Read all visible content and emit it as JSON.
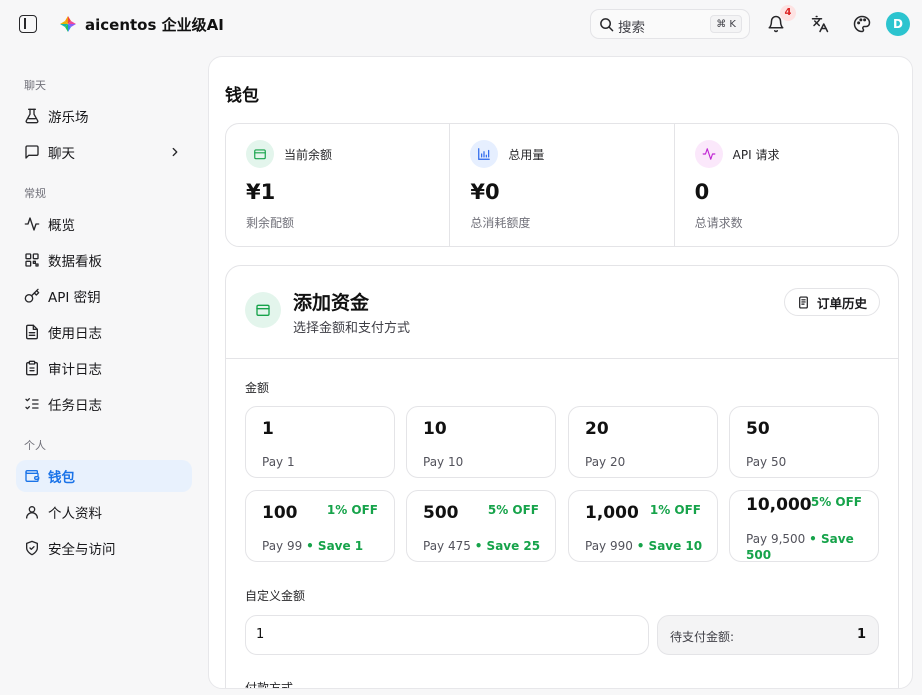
{
  "header": {
    "brand": "aicentos 企业级AI",
    "search_placeholder": "搜索",
    "search_shortcut": "⌘ K",
    "notification_count": "4",
    "avatar_initial": "D"
  },
  "sidebar": {
    "section_chat": "聊天",
    "section_general": "常规",
    "section_personal": "个人",
    "items": [
      {
        "label": "游乐场",
        "icon": "flask-icon"
      },
      {
        "label": "聊天",
        "icon": "message-square-icon"
      },
      {
        "label": "概览",
        "icon": "activity-icon"
      },
      {
        "label": "数据看板",
        "icon": "dashboard-icon"
      },
      {
        "label": "API 密钥",
        "icon": "key-icon"
      },
      {
        "label": "使用日志",
        "icon": "file-text-icon"
      },
      {
        "label": "审计日志",
        "icon": "clipboard-icon"
      },
      {
        "label": "任务日志",
        "icon": "list-checks-icon"
      },
      {
        "label": "钱包",
        "icon": "wallet-icon",
        "active": true
      },
      {
        "label": "个人资料",
        "icon": "user-icon"
      },
      {
        "label": "安全与访问",
        "icon": "shield-icon"
      }
    ]
  },
  "page": {
    "title": "钱包",
    "stats": [
      {
        "label": "当前余额",
        "value": "¥1",
        "sub": "剩余配额",
        "icon": "wallet-icon",
        "color": "#16a34a",
        "bg": "#e3f5ec"
      },
      {
        "label": "总用量",
        "value": "¥0",
        "sub": "总消耗额度",
        "icon": "bar-chart-icon",
        "color": "#2563eb",
        "bg": "#e6efff"
      },
      {
        "label": "API 请求",
        "value": "0",
        "sub": "总请求数",
        "icon": "activity-icon",
        "color": "#c026d3",
        "bg": "#fbe8fb"
      }
    ],
    "fund": {
      "title": "添加资金",
      "subtitle": "选择金额和支付方式",
      "order_history": "订单历史",
      "amount_label": "金额",
      "amounts": [
        {
          "value": "1",
          "pay": "Pay 1",
          "off": "",
          "save": ""
        },
        {
          "value": "10",
          "pay": "Pay 10",
          "off": "",
          "save": ""
        },
        {
          "value": "20",
          "pay": "Pay 20",
          "off": "",
          "save": ""
        },
        {
          "value": "50",
          "pay": "Pay 50",
          "off": "",
          "save": ""
        },
        {
          "value": "100",
          "pay": "Pay 99",
          "off": "1% OFF",
          "save": "• Save 1"
        },
        {
          "value": "500",
          "pay": "Pay 475",
          "off": "5% OFF",
          "save": "• Save 25"
        },
        {
          "value": "1,000",
          "pay": "Pay 990",
          "off": "1% OFF",
          "save": "• Save 10"
        },
        {
          "value": "10,000",
          "pay": "Pay 9,500",
          "off": "5% OFF",
          "save": "• Save 500"
        }
      ],
      "custom_label": "自定义金额",
      "custom_value": "1",
      "pay_label": "待支付金额:",
      "pay_value": "1",
      "payment_method_label": "付款方式"
    }
  }
}
